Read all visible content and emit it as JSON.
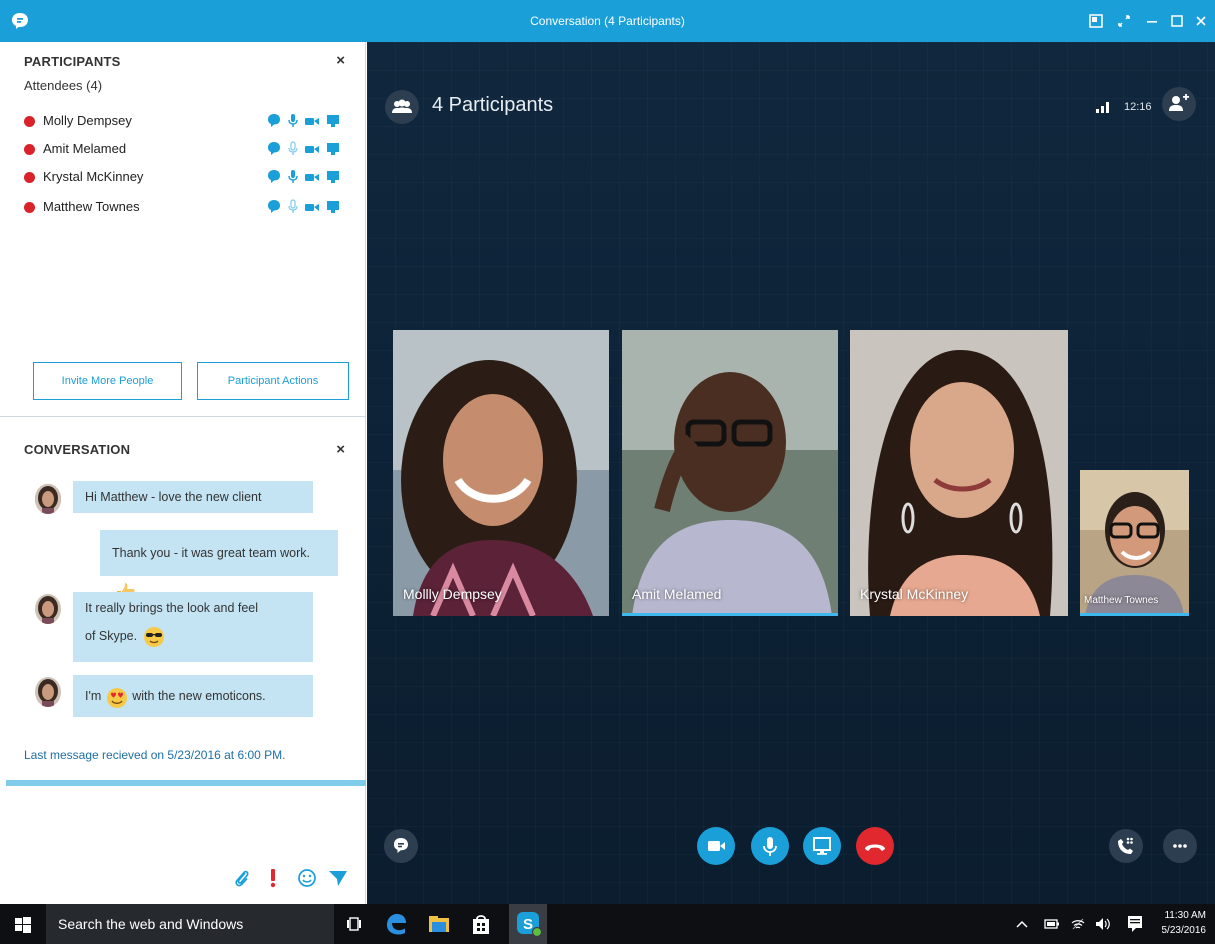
{
  "window": {
    "title": "Conversation (4 Participants)"
  },
  "participants_panel": {
    "heading": "PARTICIPANTS",
    "close": "×",
    "attendees_label": "Attendees (4)",
    "list": [
      {
        "name": "Molly Dempsey",
        "mic": "active"
      },
      {
        "name": "Amit Melamed",
        "mic": "muted"
      },
      {
        "name": "Krystal McKinney",
        "mic": "active"
      },
      {
        "name": "Matthew Townes",
        "mic": "muted"
      }
    ],
    "invite_button": "Invite More People",
    "actions_button": "Participant Actions"
  },
  "conversation_panel": {
    "heading": "CONVERSATION",
    "close": "×",
    "messages": [
      {
        "text": "Hi Matthew - love the new client"
      },
      {
        "text": "Thank you - it was great team work."
      },
      {
        "line1": "It really brings the look and feel",
        "line2": "of Skype."
      },
      {
        "before": "I'm",
        "after": "with the new emoticons."
      }
    ],
    "last_message": "Last message recieved on 5/23/2016 at 6:00 PM."
  },
  "call": {
    "title": "4 Participants",
    "time": "12:16",
    "tiles": [
      {
        "name": "Mollly Dempsey",
        "speaking": false
      },
      {
        "name": "Amit Melamed",
        "speaking": true
      },
      {
        "name": "Krystal McKinney",
        "speaking": false
      },
      {
        "name": "Matthew Townes",
        "speaking": true
      }
    ]
  },
  "taskbar": {
    "search_placeholder": "Search the web and Windows",
    "time": "11:30 AM",
    "date": "5/23/2016"
  },
  "colors": {
    "accent": "#1a9fd9",
    "presence_busy": "#d8232a",
    "hangup": "#e0282e",
    "bubble": "#c4e4f4"
  },
  "icons": [
    "skype-chat-icon",
    "group-icon",
    "signal-icon",
    "add-person-icon",
    "video-icon",
    "mic-icon",
    "screen-share-icon",
    "hang-up-icon",
    "dialpad-icon",
    "more-icon",
    "attach-icon",
    "importance-icon",
    "emoticon-icon",
    "send-icon"
  ]
}
